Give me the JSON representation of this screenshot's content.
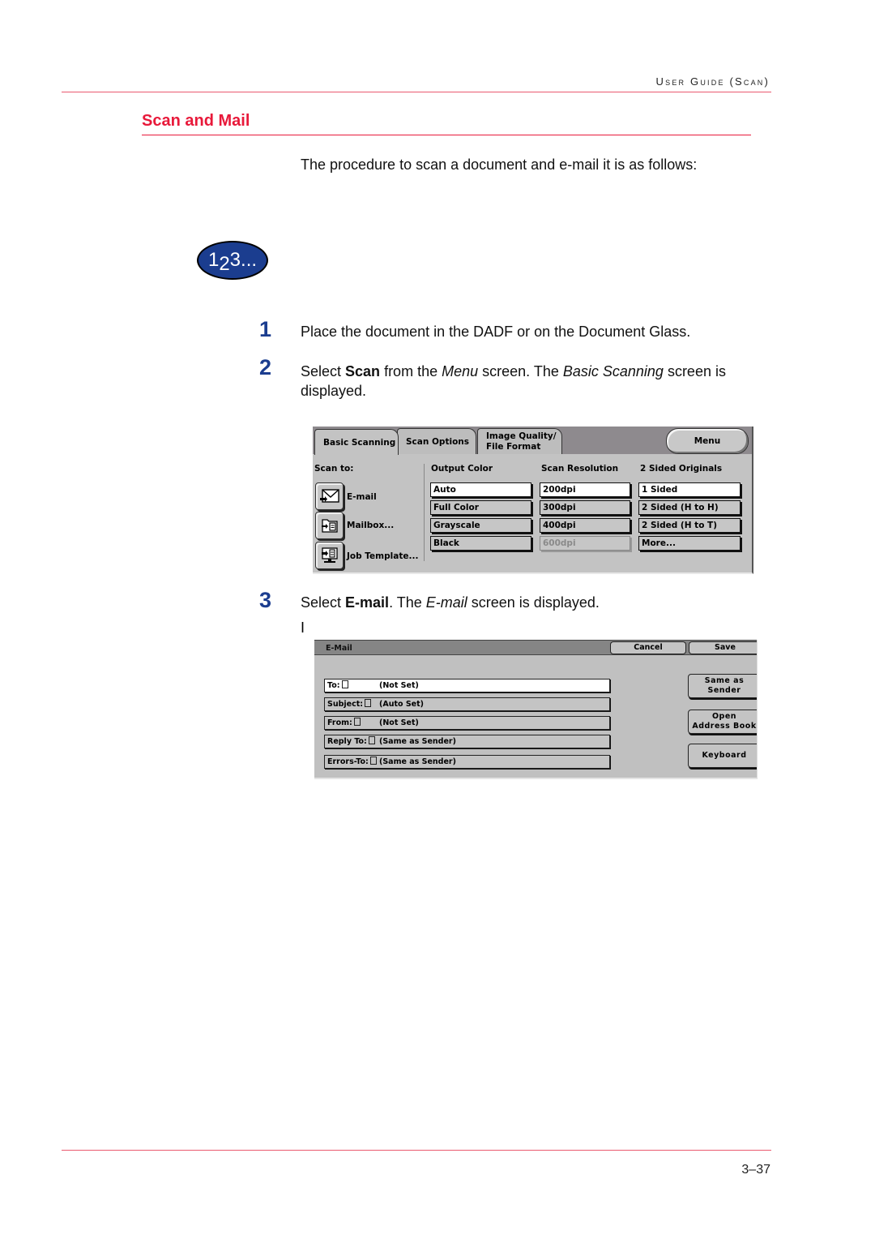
{
  "header": {
    "running_head_1": "User Guide",
    "running_head_2": "(Scan)"
  },
  "section": {
    "title": "Scan and Mail",
    "intro": "The procedure to scan a document and e-mail it is as follows:"
  },
  "badge": {
    "part1": "1",
    "part2": "2",
    "part3": "3..."
  },
  "steps": [
    {
      "number": "1",
      "text": "Place the document in the DADF or on the Document Glass."
    },
    {
      "number": "2",
      "text_pre": "Select ",
      "bold": "Scan",
      "text_mid": " from the ",
      "italic1": "Menu",
      "text_mid2": " screen. The ",
      "italic2": "Basic Scanning",
      "text_post": " screen is displayed."
    },
    {
      "number": "3",
      "text_pre": "Select ",
      "bold": "E-mail",
      "text_mid": ". The ",
      "italic1": "E-mail",
      "text_post": " screen is displayed."
    }
  ],
  "stray_char": "I",
  "basic_scanning_screen": {
    "tabs": [
      {
        "label": "Basic Scanning",
        "active": true
      },
      {
        "label": "Scan Options",
        "active": false
      },
      {
        "label_line1": "Image Quality/",
        "label_line2": "File Format",
        "active": false
      }
    ],
    "menu_button": "Menu",
    "scan_to_label": "Scan to:",
    "scan_to_items": [
      {
        "label": "E-mail",
        "icon": "envelope-icon"
      },
      {
        "label": "Mailbox...",
        "icon": "mailbox-icon"
      },
      {
        "label": "Job Template...",
        "icon": "job-template-icon"
      }
    ],
    "columns": [
      {
        "header": "Output Color",
        "options": [
          {
            "label": "Auto",
            "selected": true,
            "disabled": false
          },
          {
            "label": "Full Color",
            "selected": false,
            "disabled": false
          },
          {
            "label": "Grayscale",
            "selected": false,
            "disabled": false
          },
          {
            "label": "Black",
            "selected": false,
            "disabled": false
          }
        ]
      },
      {
        "header": "Scan Resolution",
        "options": [
          {
            "label": "200dpi",
            "selected": true,
            "disabled": false
          },
          {
            "label": "300dpi",
            "selected": false,
            "disabled": false
          },
          {
            "label": "400dpi",
            "selected": false,
            "disabled": false
          },
          {
            "label": "600dpi",
            "selected": false,
            "disabled": true
          }
        ]
      },
      {
        "header": "2 Sided Originals",
        "options": [
          {
            "label": "1 Sided",
            "selected": true,
            "disabled": false
          },
          {
            "label": "2 Sided (H to H)",
            "selected": false,
            "disabled": false
          },
          {
            "label": "2 Sided (H to T)",
            "selected": false,
            "disabled": false
          },
          {
            "label": "More...",
            "selected": false,
            "disabled": false
          }
        ]
      }
    ]
  },
  "email_screen": {
    "title": "E-Mail",
    "cancel": "Cancel",
    "save": "Save",
    "fields": [
      {
        "label": "To:",
        "value": "(Not Set)",
        "selected": true
      },
      {
        "label": "Subject:",
        "value": "(Auto Set)",
        "selected": false
      },
      {
        "label": "From:",
        "value": "(Not Set)",
        "selected": false
      },
      {
        "label": "Reply To:",
        "value": "(Same as Sender)",
        "selected": false
      },
      {
        "label": "Errors-To:",
        "value": "(Same as Sender)",
        "selected": false
      }
    ],
    "side_buttons": [
      {
        "line1": "Same as",
        "line2": "Sender"
      },
      {
        "line1": "Open",
        "line2": "Address Book"
      },
      {
        "line1": "Keyboard",
        "line2": ""
      }
    ]
  },
  "footer": {
    "page_number": "3–37"
  },
  "colors": {
    "accent_red": "#e8193a",
    "rule_pink": "#ea5a6f",
    "step_blue": "#1b3d8f"
  }
}
